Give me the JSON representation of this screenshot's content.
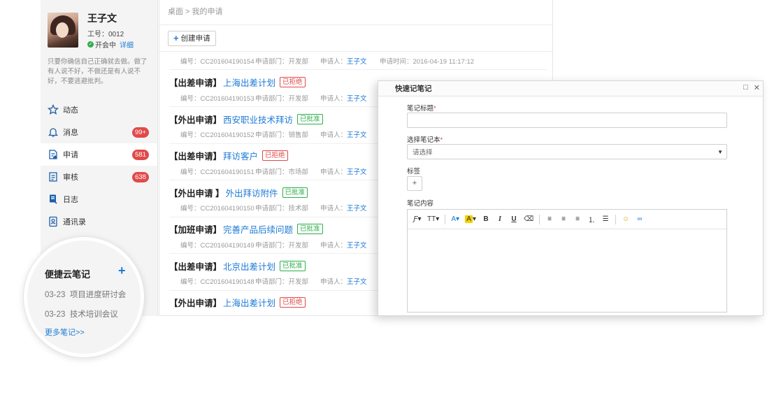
{
  "user": {
    "name": "王子文",
    "id_text": "工号：0012",
    "status": "开会中",
    "detail_link": "详细",
    "motto": "只要你确信自己正确就去做。做了有人说不好，不做还是有人说不好，不要逃避批判。"
  },
  "nav": {
    "items": [
      {
        "label": "动态",
        "icon": "star-icon",
        "badge": ""
      },
      {
        "label": "消息",
        "icon": "bell-icon",
        "badge": "99+"
      },
      {
        "label": "申请",
        "icon": "apply-icon",
        "badge": "581"
      },
      {
        "label": "审核",
        "icon": "review-icon",
        "badge": "638"
      },
      {
        "label": "日志",
        "icon": "log-icon",
        "badge": ""
      },
      {
        "label": "通讯录",
        "icon": "contacts-icon",
        "badge": ""
      }
    ]
  },
  "breadcrumb": "桌面 > 我的申请",
  "toolbar": {
    "create_label": "创建申请"
  },
  "first_meta": {
    "code": "编号：CC201604190154",
    "dept": "申请部门：开发部",
    "applicant_label": "申请人：",
    "applicant": "王子文",
    "time": "申请时间：2016-04-19 11:17:12"
  },
  "requests": [
    {
      "type": "【出差申请】",
      "name": "上海出差计划",
      "status": "已拒绝",
      "status_kind": "rejected",
      "code": "编号：CC201604190153",
      "dept": "申请部门：开发部",
      "applicant_label": "申请人：",
      "applicant": "王子文"
    },
    {
      "type": "【外出申请】",
      "name": "西安职业技术拜访",
      "status": "已批准",
      "status_kind": "approved",
      "code": "编号：CC201604190152",
      "dept": "申请部门：销售部",
      "applicant_label": "申请人：",
      "applicant": "王子文"
    },
    {
      "type": "【出差申请】",
      "name": "拜访客户",
      "status": "已拒绝",
      "status_kind": "rejected",
      "code": "编号：CC201604190151",
      "dept": "申请部门：市场部",
      "applicant_label": "申请人：",
      "applicant": "王子文"
    },
    {
      "type": "【外出申请 】",
      "name": "外出拜访附件",
      "status": "已批准",
      "status_kind": "approved",
      "code": "编号：CC201604190150",
      "dept": "申请部门：技术部",
      "applicant_label": "申请人：",
      "applicant": "王子文"
    },
    {
      "type": "【加班申请】",
      "name": "完善产品后续问题",
      "status": "已批准",
      "status_kind": "approved",
      "code": "编号：CC201604190149",
      "dept": "申请部门：开发部",
      "applicant_label": "申请人：",
      "applicant": "王子文"
    },
    {
      "type": "【出差申请】",
      "name": "北京出差计划",
      "status": "已批准",
      "status_kind": "approved",
      "code": "编号：CC201604190148",
      "dept": "申请部门：开发部",
      "applicant_label": "申请人：",
      "applicant": "王子文"
    },
    {
      "type": "【外出申请】",
      "name": "上海出差计划",
      "status": "已拒绝",
      "status_kind": "rejected",
      "code": "",
      "dept": "",
      "applicant_label": "",
      "applicant": ""
    }
  ],
  "dialog": {
    "title": "快速记笔记",
    "note_title_label": "笔记标题",
    "notebook_label": "选择笔记本",
    "notebook_placeholder": "请选择",
    "tags_label": "标签",
    "add_tag": "+",
    "content_label": "笔记内容",
    "required_mark": "*"
  },
  "magnifier": {
    "title": "便捷云笔记",
    "add": "+",
    "notes": [
      {
        "date": "03-23",
        "title": "项目进度研讨会"
      },
      {
        "date": "03-23",
        "title": "技术培训会议"
      }
    ],
    "more": "更多笔记>>"
  },
  "colors": {
    "accent": "#1e7ad6",
    "badge": "#e14a4a",
    "approved": "#2fae4b"
  }
}
